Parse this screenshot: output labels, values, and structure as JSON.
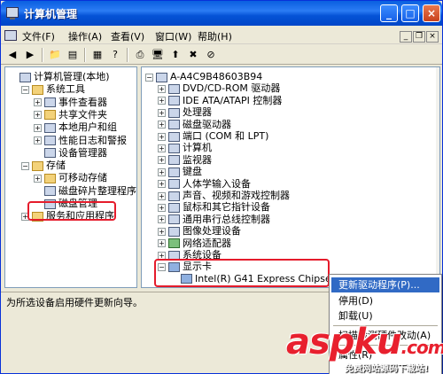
{
  "window": {
    "title": "计算机管理"
  },
  "menu": [
    "文件(F)",
    "操作(A)",
    "查看(V)",
    "窗口(W)",
    "帮助(H)"
  ],
  "tree_left": [
    {
      "label": "计算机管理(本地)",
      "indent": 0,
      "exp": "",
      "icon": "computer-icon"
    },
    {
      "label": "系统工具",
      "indent": 1,
      "exp": "−",
      "icon": "tools-icon"
    },
    {
      "label": "事件查看器",
      "indent": 2,
      "exp": "+",
      "icon": "event-viewer-icon"
    },
    {
      "label": "共享文件夹",
      "indent": 2,
      "exp": "+",
      "icon": "shared-folder-icon"
    },
    {
      "label": "本地用户和组",
      "indent": 2,
      "exp": "+",
      "icon": "users-icon"
    },
    {
      "label": "性能日志和警报",
      "indent": 2,
      "exp": "+",
      "icon": "performance-icon"
    },
    {
      "label": "设备管理器",
      "indent": 2,
      "exp": "",
      "icon": "device-manager-icon"
    },
    {
      "label": "存储",
      "indent": 1,
      "exp": "−",
      "icon": "storage-icon"
    },
    {
      "label": "可移动存储",
      "indent": 2,
      "exp": "+",
      "icon": "removable-storage-icon"
    },
    {
      "label": "磁盘碎片整理程序",
      "indent": 2,
      "exp": "",
      "icon": "defrag-icon"
    },
    {
      "label": "磁盘管理",
      "indent": 2,
      "exp": "",
      "icon": "disk-management-icon"
    },
    {
      "label": "服务和应用程序",
      "indent": 1,
      "exp": "+",
      "icon": "services-icon"
    }
  ],
  "tree_right": [
    {
      "label": "A-A4C9B48603B94",
      "indent": 0,
      "exp": "−",
      "icon": "computer-icon"
    },
    {
      "label": "DVD/CD-ROM 驱动器",
      "indent": 1,
      "exp": "+",
      "icon": "dvd-icon"
    },
    {
      "label": "IDE ATA/ATAPI 控制器",
      "indent": 1,
      "exp": "+",
      "icon": "ide-icon"
    },
    {
      "label": "处理器",
      "indent": 1,
      "exp": "+",
      "icon": "cpu-icon"
    },
    {
      "label": "磁盘驱动器",
      "indent": 1,
      "exp": "+",
      "icon": "disk-icon"
    },
    {
      "label": "端口 (COM 和 LPT)",
      "indent": 1,
      "exp": "+",
      "icon": "port-icon"
    },
    {
      "label": "计算机",
      "indent": 1,
      "exp": "+",
      "icon": "computer-icon"
    },
    {
      "label": "监视器",
      "indent": 1,
      "exp": "+",
      "icon": "monitor-icon"
    },
    {
      "label": "键盘",
      "indent": 1,
      "exp": "+",
      "icon": "keyboard-icon"
    },
    {
      "label": "人体学输入设备",
      "indent": 1,
      "exp": "+",
      "icon": "hid-icon"
    },
    {
      "label": "声音、视频和游戏控制器",
      "indent": 1,
      "exp": "+",
      "icon": "sound-icon"
    },
    {
      "label": "鼠标和其它指针设备",
      "indent": 1,
      "exp": "+",
      "icon": "mouse-icon"
    },
    {
      "label": "通用串行总线控制器",
      "indent": 1,
      "exp": "+",
      "icon": "usb-icon"
    },
    {
      "label": "图像处理设备",
      "indent": 1,
      "exp": "+",
      "icon": "imaging-icon"
    },
    {
      "label": "网络适配器",
      "indent": 1,
      "exp": "+",
      "icon": "network-icon"
    },
    {
      "label": "系统设备",
      "indent": 1,
      "exp": "+",
      "icon": "system-device-icon"
    },
    {
      "label": "显示卡",
      "indent": 1,
      "exp": "−",
      "icon": "display-icon"
    },
    {
      "label": "Intel(R) G41 Express Chipset",
      "indent": 2,
      "exp": "",
      "icon": "display-adapter-icon"
    }
  ],
  "context_menu": {
    "update_driver": "更新驱动程序(P)...",
    "disable": "停用(D)",
    "uninstall": "卸载(U)",
    "scan": "扫描检测硬件改动(A)",
    "properties": "属性(R)"
  },
  "status": "为所选设备启用硬件更新向导。",
  "watermark": {
    "logo": "aspku",
    "logo_suffix": ".com",
    "tagline": "免费网站源码下载站!"
  },
  "colors": {
    "titlebar": "#0553d6",
    "highlight": "#e51b2b",
    "menu_selected": "#316ac5"
  }
}
